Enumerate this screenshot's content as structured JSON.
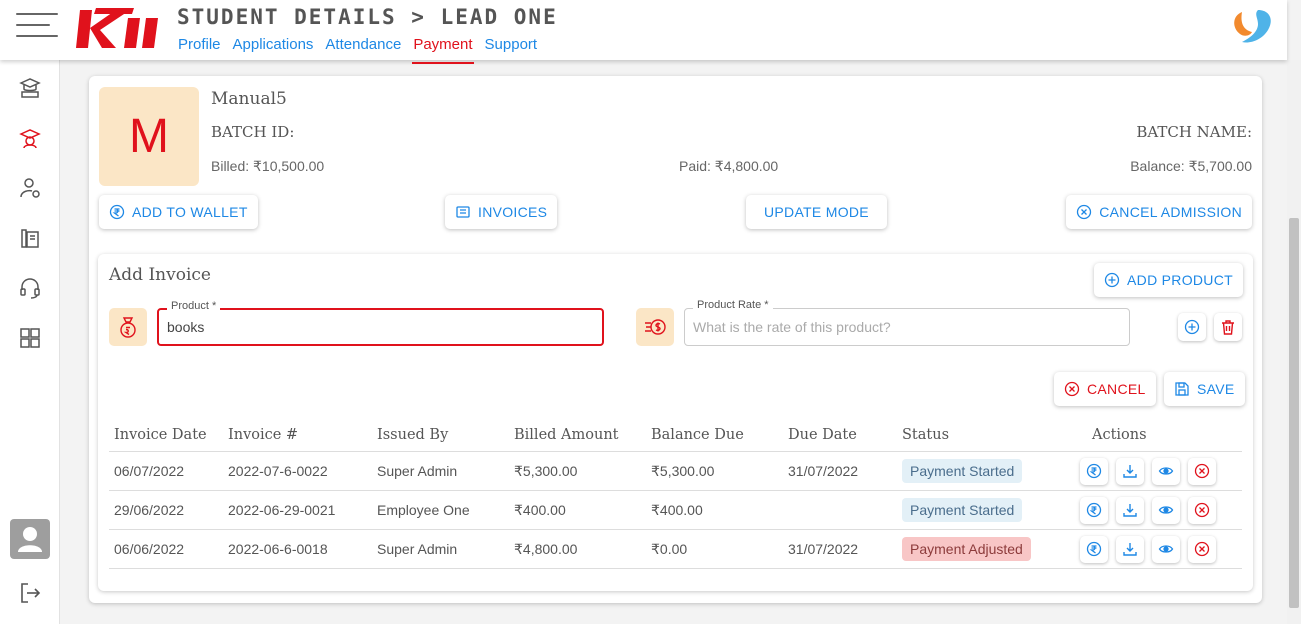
{
  "header": {
    "title": "STUDENT DETAILS > LEAD ONE",
    "tabs": [
      {
        "label": "Profile",
        "active": false
      },
      {
        "label": "Applications",
        "active": false
      },
      {
        "label": "Attendance",
        "active": false
      },
      {
        "label": "Payment",
        "active": true
      },
      {
        "label": "Support",
        "active": false
      }
    ],
    "logo_text": "Kii"
  },
  "sidebar": {
    "items": [
      {
        "icon": "courses-icon"
      },
      {
        "icon": "student-icon",
        "active": true
      },
      {
        "icon": "user-manage-icon"
      },
      {
        "icon": "books-icon"
      },
      {
        "icon": "headset-icon"
      },
      {
        "icon": "dashboard-grid-icon"
      }
    ],
    "bottom": [
      {
        "icon": "user-avatar-icon"
      },
      {
        "icon": "logout-icon"
      }
    ]
  },
  "student": {
    "initial": "M",
    "name": "Manual5",
    "batch_id_label": "BATCH ID:",
    "batch_name_label": "BATCH NAME:",
    "billed": "Billed: ₹10,500.00",
    "paid": "Paid: ₹4,800.00",
    "balance": "Balance: ₹5,700.00"
  },
  "actions": {
    "add_to_wallet": "ADD TO WALLET",
    "invoices": "INVOICES",
    "update_mode": "UPDATE MODE",
    "cancel_admission": "CANCEL ADMISSION"
  },
  "invoice_form": {
    "title": "Add Invoice",
    "add_product": "ADD PRODUCT",
    "product_label": "Product *",
    "product_value": "books",
    "rate_label": "Product Rate *",
    "rate_placeholder": "What is the rate of this product?",
    "cancel": "CANCEL",
    "save": "SAVE"
  },
  "table": {
    "headers": [
      "Invoice Date",
      "Invoice #",
      "Issued By",
      "Billed Amount",
      "Balance Due",
      "Due Date",
      "Status",
      "Actions"
    ],
    "rows": [
      {
        "date": "06/07/2022",
        "number": "2022-07-6-0022",
        "issued_by": "Super Admin",
        "billed": "₹5,300.00",
        "balance": "₹5,300.00",
        "due": "31/07/2022",
        "status": "Payment Started"
      },
      {
        "date": "29/06/2022",
        "number": "2022-06-29-0021",
        "issued_by": "Employee One",
        "billed": "₹400.00",
        "balance": "₹400.00",
        "due": "",
        "status": "Payment Started"
      },
      {
        "date": "06/06/2022",
        "number": "2022-06-6-0018",
        "issued_by": "Super Admin",
        "billed": "₹4,800.00",
        "balance": "₹0.00",
        "due": "31/07/2022",
        "status": "Payment Adjusted"
      }
    ]
  },
  "colors": {
    "accent": "#1e88e5",
    "brand_red": "#e0121c",
    "avatar_bg": "#fbe6c6"
  }
}
